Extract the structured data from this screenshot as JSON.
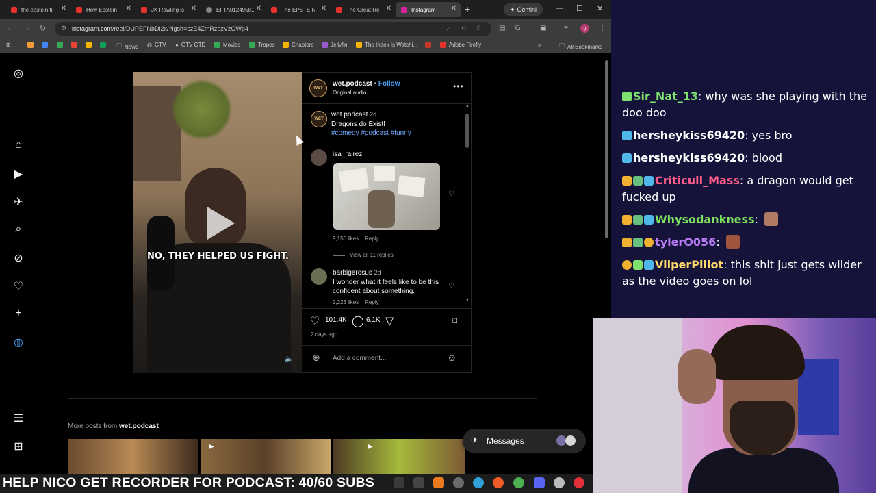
{
  "browser": {
    "tabs": [
      {
        "label": "the epstein fil",
        "color": "#e5322d"
      },
      {
        "label": "How Epstein",
        "color": "#e5322d"
      },
      {
        "label": "JK Rowling is",
        "color": "#e5322d"
      },
      {
        "label": "EFTA01249581",
        "color": "#888888"
      },
      {
        "label": "The EPSTEIN",
        "color": "#e5322d"
      },
      {
        "label": "The Great Re",
        "color": "#e5322d"
      },
      {
        "label": "Instagram",
        "color": "#d6249f"
      }
    ],
    "gemini_label": "Gemini",
    "url_host": "instagram.com",
    "url_path": "/reel/DUPEFNbDl2x/?igsh=czE4ZmRzbzVzOWp4",
    "profile_initial": "g",
    "bookmarks": [
      {
        "label": "",
        "color": "#f29b38"
      },
      {
        "label": "",
        "color": "#4285f4"
      },
      {
        "label": "",
        "color": "#34a853"
      },
      {
        "label": "",
        "color": "#ea4335"
      },
      {
        "label": "",
        "color": "#f4b400"
      },
      {
        "label": "",
        "color": "#0f9d58"
      },
      {
        "label": "News",
        "color": "#9aa0a6"
      },
      {
        "label": "GTV",
        "color": "#9aa0a6"
      },
      {
        "label": "GTV GTD",
        "color": "#e8e8e8"
      },
      {
        "label": "Movies",
        "color": "#34a853"
      },
      {
        "label": "Tropes",
        "color": "#34a853"
      },
      {
        "label": "Chapters",
        "color": "#f4b400"
      },
      {
        "label": "Jellyfin",
        "color": "#9b59d0"
      },
      {
        "label": "The Index Is Watchi...",
        "color": "#f4b400"
      },
      {
        "label": "",
        "color": "#c0392b"
      },
      {
        "label": "Adobe Firefly",
        "color": "#e5322d"
      }
    ],
    "all_bookmarks": "All Bookmarks"
  },
  "post": {
    "caption": "NO, THEY HELPED US FIGHT.",
    "username": "wet.podcast",
    "follow": "Follow",
    "audio": "Original audio",
    "avatar_text": "WET",
    "description": {
      "user": "wet.podcast",
      "time": "2d",
      "text": "Dragons do Exist!",
      "hashtags": "#comedy #podcast #funny"
    },
    "comments": [
      {
        "user": "isa_rairez",
        "likes": "9,150 likes",
        "reply": "Reply",
        "view_replies": "View all 11 replies"
      },
      {
        "user": "barbigerosus",
        "time": "2d",
        "text": "I wonder what it feels like to be this confident about something.",
        "likes": "2,223 likes",
        "reply": "Reply"
      }
    ],
    "like_count": "101.4K",
    "comment_count": "6.1K",
    "posted_ago": "2 days ago",
    "add_comment_placeholder": "Add a comment...",
    "more_posts_prefix": "More posts from",
    "more_posts_user": "wet.podcast",
    "messages_label": "Messages"
  },
  "chat": [
    {
      "user": "Sir_Nat_13",
      "color": "#7ee06f",
      "message": "why was she playing with the doo doo"
    },
    {
      "user": "hersheykiss69420",
      "color": "#ffffff",
      "message": "yes bro"
    },
    {
      "user": "hersheykiss69420",
      "color": "#ffffff",
      "message": "blood"
    },
    {
      "user": "Criticull_Mass",
      "color": "#ff5c8a",
      "message": "a dragon would get fucked up"
    },
    {
      "user": "Whysodankness",
      "color": "#7de35f",
      "message": ""
    },
    {
      "user": "tylerO056",
      "color": "#b77cf5",
      "message": ""
    },
    {
      "user": "ViiperPiilot",
      "color": "#ffd86b",
      "message": "this shit just gets wilder as the video goes on lol"
    }
  ],
  "banner": "HELP NICO GET RECORDER FOR PODCAST: 40/60 SUBS"
}
